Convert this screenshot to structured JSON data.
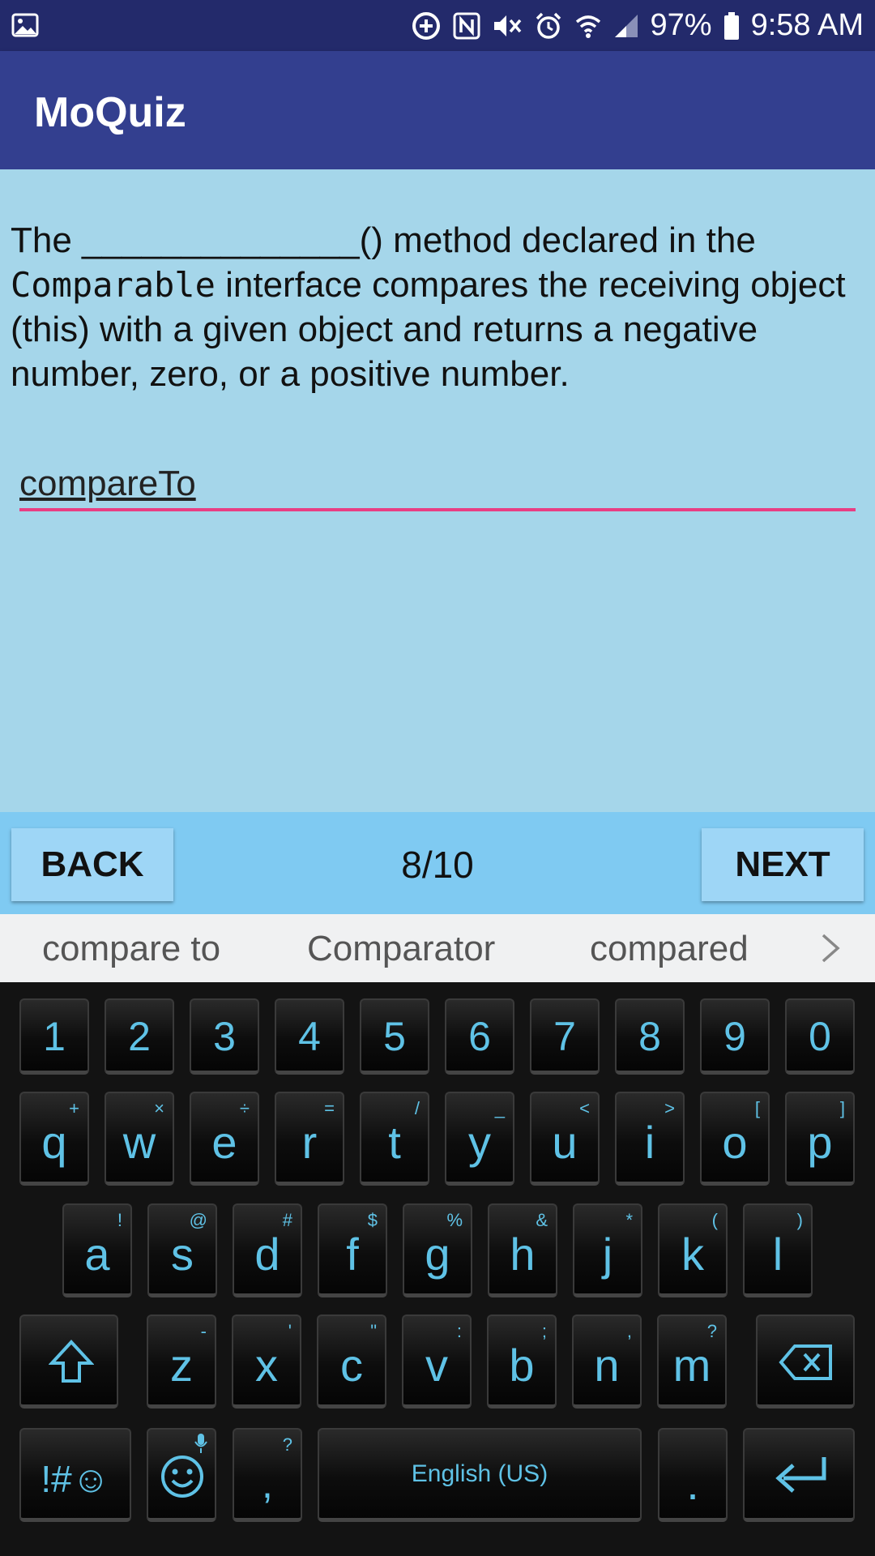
{
  "status_bar": {
    "battery": "97%",
    "time": "9:58 AM"
  },
  "app": {
    "title": "MoQuiz"
  },
  "question": {
    "prefix": "The ",
    "blank": "______________",
    "after_blank": "() method declared in the ",
    "code": "Comparable",
    "suffix": " interface compares the receiving object (this) with a given object and returns a negative number, zero, or a positive number."
  },
  "answer": {
    "value": "compareTo"
  },
  "nav": {
    "back_label": "BACK",
    "progress": "8/10",
    "next_label": "NEXT"
  },
  "suggestions": [
    "compare to",
    "Comparator",
    "compared"
  ],
  "keyboard": {
    "numbers": [
      "1",
      "2",
      "3",
      "4",
      "5",
      "6",
      "7",
      "8",
      "9",
      "0"
    ],
    "row1": [
      {
        "k": "q",
        "s": "+"
      },
      {
        "k": "w",
        "s": "×"
      },
      {
        "k": "e",
        "s": "÷"
      },
      {
        "k": "r",
        "s": "="
      },
      {
        "k": "t",
        "s": "/"
      },
      {
        "k": "y",
        "s": "_"
      },
      {
        "k": "u",
        "s": "<"
      },
      {
        "k": "i",
        "s": ">"
      },
      {
        "k": "o",
        "s": "["
      },
      {
        "k": "p",
        "s": "]"
      }
    ],
    "row2": [
      {
        "k": "a",
        "s": "!"
      },
      {
        "k": "s",
        "s": "@"
      },
      {
        "k": "d",
        "s": "#"
      },
      {
        "k": "f",
        "s": "$"
      },
      {
        "k": "g",
        "s": "%"
      },
      {
        "k": "h",
        "s": "&"
      },
      {
        "k": "j",
        "s": "*"
      },
      {
        "k": "k",
        "s": "("
      },
      {
        "k": "l",
        "s": ")"
      }
    ],
    "row3": [
      {
        "k": "z",
        "s": "-"
      },
      {
        "k": "x",
        "s": "'"
      },
      {
        "k": "c",
        "s": "\""
      },
      {
        "k": "v",
        "s": ":"
      },
      {
        "k": "b",
        "s": ";"
      },
      {
        "k": "n",
        "s": ","
      },
      {
        "k": "m",
        "s": "?"
      }
    ],
    "symbols_label": "!#☺",
    "comma": ",",
    "comma_sub": "?",
    "space_label": "English (US)",
    "period": "."
  },
  "icons": {
    "status_left": "image-icon",
    "status_right": [
      "data-saver-icon",
      "nfc-icon",
      "mute-icon",
      "alarm-icon",
      "wifi-icon",
      "signal-icon",
      "battery-icon"
    ],
    "keyboard": [
      "shift-icon",
      "backspace-icon",
      "emoji-icon",
      "mic-icon",
      "enter-icon"
    ],
    "suggestions": "chevron-right-icon"
  },
  "colors": {
    "status_bar": "#232a6b",
    "app_bar": "#333f8f",
    "content_bg": "#a5d6ea",
    "nav_bar": "#7fcaf2",
    "input_underline": "#e83e83",
    "key_text": "#5fc2e6"
  }
}
